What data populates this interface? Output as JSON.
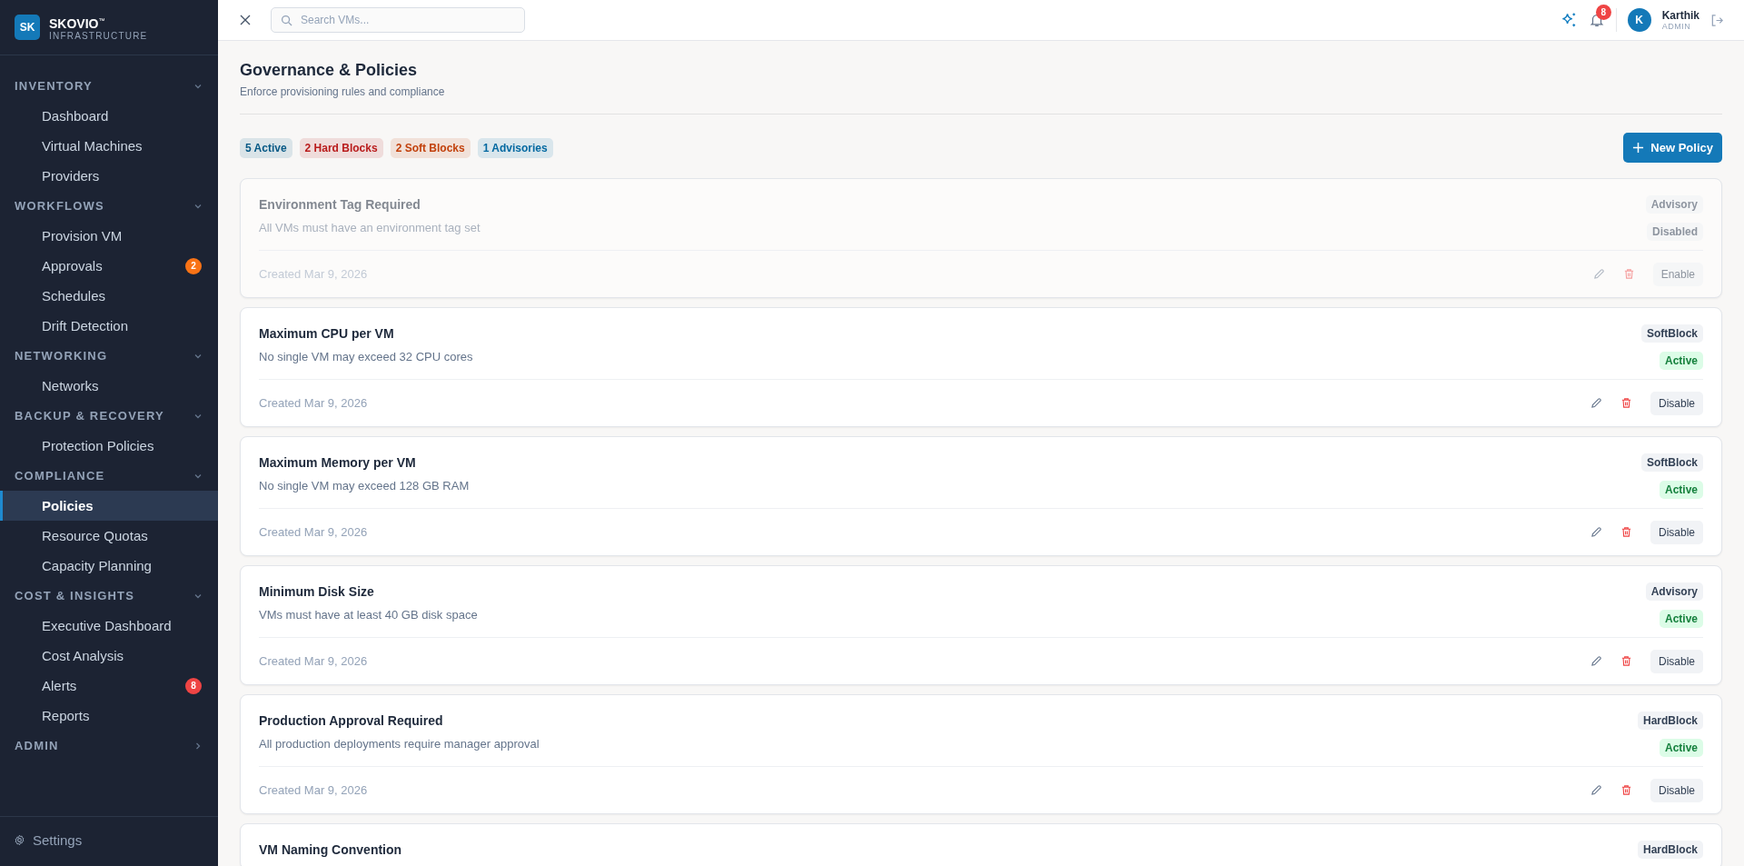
{
  "brand": {
    "logo": "SK",
    "name": "SKOVIO",
    "trademark": "™",
    "tagline": "INFRASTRUCTURE"
  },
  "sidebar": {
    "sections": [
      {
        "title": "INVENTORY",
        "expanded": true,
        "items": [
          {
            "label": "Dashboard",
            "selected": false
          },
          {
            "label": "Virtual Machines",
            "selected": false
          },
          {
            "label": "Providers",
            "selected": false
          }
        ]
      },
      {
        "title": "WORKFLOWS",
        "expanded": true,
        "items": [
          {
            "label": "Provision VM",
            "selected": false
          },
          {
            "label": "Approvals",
            "selected": false,
            "badge": "2",
            "color": "#f97316"
          },
          {
            "label": "Schedules",
            "selected": false
          },
          {
            "label": "Drift Detection",
            "selected": false
          }
        ]
      },
      {
        "title": "NETWORKING",
        "expanded": true,
        "items": [
          {
            "label": "Networks",
            "selected": false
          }
        ]
      },
      {
        "title": "BACKUP & RECOVERY",
        "expanded": true,
        "items": [
          {
            "label": "Protection Policies",
            "selected": false
          }
        ]
      },
      {
        "title": "COMPLIANCE",
        "expanded": true,
        "items": [
          {
            "label": "Policies",
            "selected": true
          },
          {
            "label": "Resource Quotas",
            "selected": false
          },
          {
            "label": "Capacity Planning",
            "selected": false
          }
        ]
      },
      {
        "title": "COST & INSIGHTS",
        "expanded": true,
        "items": [
          {
            "label": "Executive Dashboard",
            "selected": false
          },
          {
            "label": "Cost Analysis",
            "selected": false
          },
          {
            "label": "Alerts",
            "selected": false,
            "badge": "8",
            "color": "#ef4444"
          },
          {
            "label": "Reports",
            "selected": false
          }
        ]
      },
      {
        "title": "ADMIN",
        "expanded": false
      }
    ],
    "footer": "Settings"
  },
  "topbar": {
    "search": {
      "placeholder": "Search VMs..."
    },
    "notifications": "8",
    "user": {
      "initial": "K",
      "name": "Karthik",
      "role": "ADMIN"
    }
  },
  "page": {
    "title": "Governance & Policies",
    "subtitle": "Enforce provisioning rules and compliance",
    "new_button": "New Policy",
    "summary": [
      {
        "label": "5 Active",
        "color": "#075985"
      },
      {
        "label": "2 Hard Blocks",
        "color": "#b91c1c"
      },
      {
        "label": "2 Soft Blocks",
        "color": "#c2410c"
      },
      {
        "label": "1 Advisories",
        "color": "#0369a1"
      }
    ]
  },
  "policies": [
    {
      "name": "Environment Tag Required",
      "description": "All VMs must have an environment tag set",
      "type": "Advisory",
      "status": "Disabled",
      "enabled": false,
      "created": "Created Mar 9, 2026",
      "action": "Enable"
    },
    {
      "name": "Maximum CPU per VM",
      "description": "No single VM may exceed 32 CPU cores",
      "type": "SoftBlock",
      "status": "Active",
      "enabled": true,
      "created": "Created Mar 9, 2026",
      "action": "Disable"
    },
    {
      "name": "Maximum Memory per VM",
      "description": "No single VM may exceed 128 GB RAM",
      "type": "SoftBlock",
      "status": "Active",
      "enabled": true,
      "created": "Created Mar 9, 2026",
      "action": "Disable"
    },
    {
      "name": "Minimum Disk Size",
      "description": "VMs must have at least 40 GB disk space",
      "type": "Advisory",
      "status": "Active",
      "enabled": true,
      "created": "Created Mar 9, 2026",
      "action": "Disable"
    },
    {
      "name": "Production Approval Required",
      "description": "All production deployments require manager approval",
      "type": "HardBlock",
      "status": "Active",
      "enabled": true,
      "created": "Created Mar 9, 2026",
      "action": "Disable"
    },
    {
      "name": "VM Naming Convention",
      "type": "HardBlock"
    }
  ]
}
